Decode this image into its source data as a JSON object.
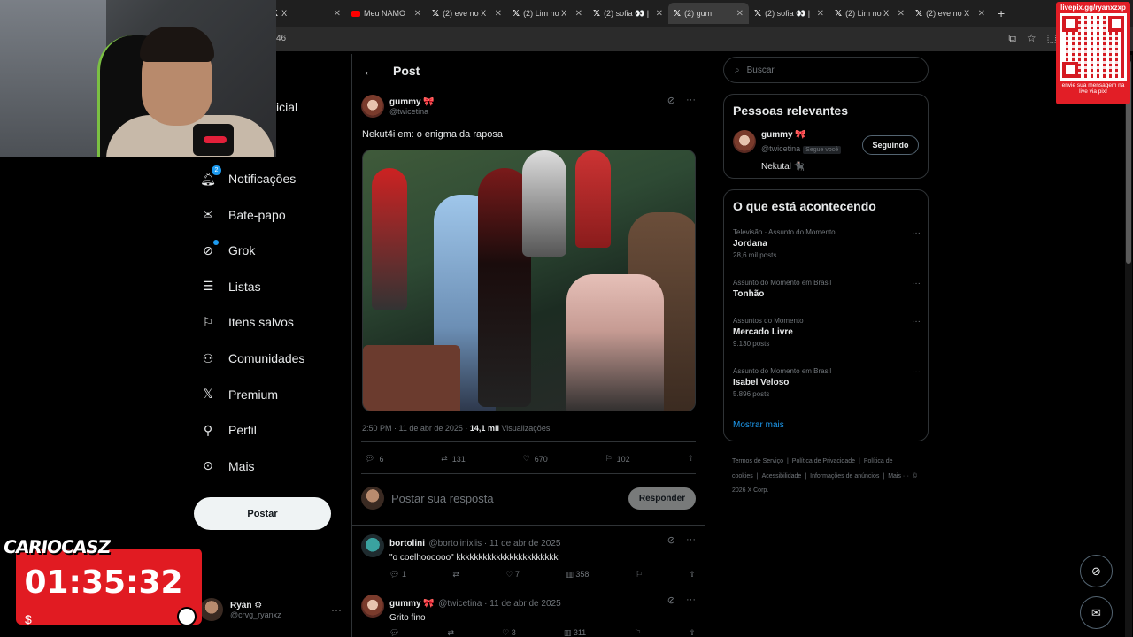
{
  "browser": {
    "tabs": [
      {
        "icon": "x-icon",
        "label": "X"
      },
      {
        "icon": "youtube-icon",
        "label": "Meu NAMO"
      },
      {
        "icon": "x-icon",
        "label": "(2) eve no X"
      },
      {
        "icon": "x-icon",
        "label": "(2) Lim no X"
      },
      {
        "icon": "x-icon",
        "label": "(2) sofia 👀 |"
      },
      {
        "icon": "x-icon",
        "label": "(2) gum"
      },
      {
        "icon": "x-icon",
        "label": "(2) sofia 👀 |"
      },
      {
        "icon": "x-icon",
        "label": "(2) Lim no X"
      },
      {
        "icon": "x-icon",
        "label": "(2) eve no X"
      }
    ],
    "url_fragment": "46"
  },
  "overlays": {
    "qr_title": "livepix.gg/ryanxzxp",
    "qr_footer": "envie sua mensagem na live via pix!",
    "brand": "CARIOCASZ",
    "timer": "01:35:32"
  },
  "nav": {
    "partial_home": "icial",
    "items": [
      {
        "label": "Notificações",
        "icon": "bell-icon",
        "badge": "2"
      },
      {
        "label": "Bate-papo",
        "icon": "mail-icon"
      },
      {
        "label": "Grok",
        "icon": "grok-icon"
      },
      {
        "label": "Listas",
        "icon": "list-icon"
      },
      {
        "label": "Itens salvos",
        "icon": "bookmark-icon"
      },
      {
        "label": "Comunidades",
        "icon": "communities-icon"
      },
      {
        "label": "Premium",
        "icon": "x-icon"
      },
      {
        "label": "Perfil",
        "icon": "person-icon"
      },
      {
        "label": "Mais",
        "icon": "more-circle-icon"
      }
    ],
    "post_button": "Postar",
    "account": {
      "name": "Ryan ⚙",
      "handle": "@crvg_ryanxz"
    }
  },
  "post": {
    "header_title": "Post",
    "author_name": "gummy 🎀",
    "author_handle": "@twicetina",
    "text": "Nekut4i em: o enigma da raposa",
    "time": "2:50 PM · 11 de abr de 2025 · ",
    "views": "14,1 mil",
    "views_label": " Visualizações",
    "stats": {
      "replies": "6",
      "reposts": "131",
      "likes": "670",
      "bookmarks": "102"
    },
    "reply_placeholder": "Postar sua resposta",
    "reply_button": "Responder"
  },
  "comments": [
    {
      "name": "bortolini",
      "handle": "@bortolinixlis · 11 de abr de 2025",
      "text": "\"o coelhoooooo\" kkkkkkkkkkkkkkkkkkkkkkk",
      "replies": "1",
      "reposts": "",
      "likes": "7",
      "views": "358"
    },
    {
      "name": "gummy 🎀",
      "handle": "@twicetina · 11 de abr de 2025",
      "text": "Grito fino",
      "replies": "",
      "reposts": "",
      "likes": "3",
      "views": "311"
    }
  ],
  "sidebar": {
    "search_placeholder": "Buscar",
    "relevant_title": "Pessoas relevantes",
    "relevant": {
      "name": "gummy 🎀",
      "handle": "@twicetina",
      "tag": "Segue você",
      "bio": "Nekutal 🐈‍⬛",
      "button": "Seguindo"
    },
    "trends_title": "O que está acontecendo",
    "trends": [
      {
        "context": "Televisão · Assunto do Momento",
        "name": "Jordana",
        "count": "28,6 mil posts"
      },
      {
        "context": "Assunto do Momento em Brasil",
        "name": "Tonhão",
        "count": ""
      },
      {
        "context": "Assuntos do Momento",
        "name": "Mercado Livre",
        "count": "9.130 posts"
      },
      {
        "context": "Assunto do Momento em Brasil",
        "name": "Isabel Veloso",
        "count": "5.896 posts"
      }
    ],
    "show_more": "Mostrar mais",
    "footer": [
      "Termos de Serviço",
      "|",
      "Política de Privacidade",
      "|",
      "Política de cookies",
      "|",
      "Acessibilidade",
      "|",
      "Informações de anúncios",
      "|",
      "Mais ···",
      "© 2026 X Corp."
    ]
  },
  "colors": {
    "accent": "#1d9bf0",
    "overlay_red": "#e11b22"
  }
}
